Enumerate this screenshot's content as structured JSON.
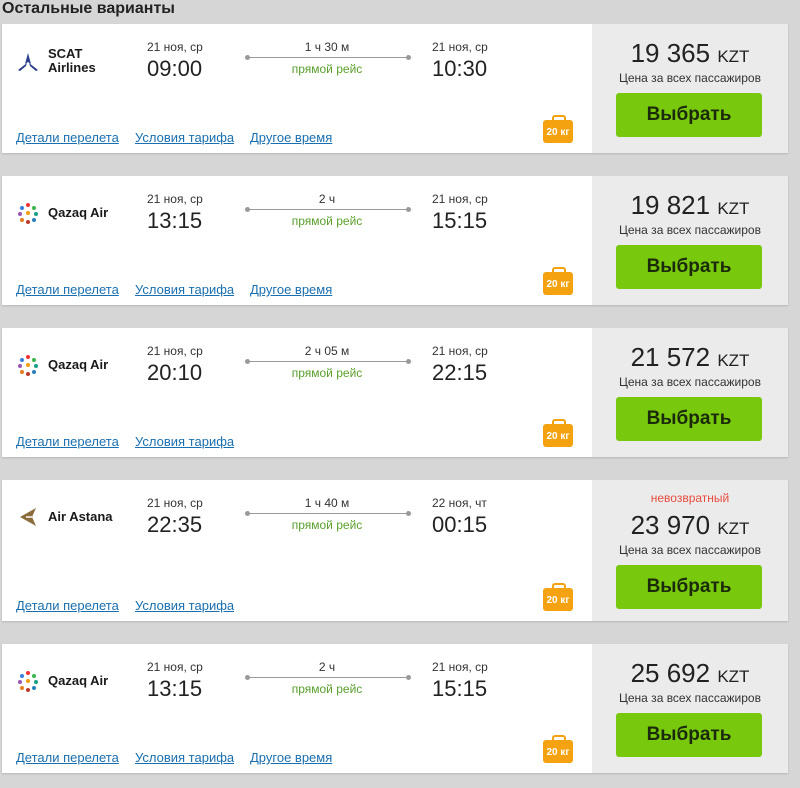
{
  "section_title": "Остальные варианты",
  "link_labels": {
    "details": "Детали перелета",
    "tariff": "Условия тарифа",
    "other_time": "Другое время"
  },
  "route_type": "прямой рейс",
  "price_note": "Цена за всех пассажиров",
  "select_label": "Выбрать",
  "baggage_label": "20 кг",
  "nonrefundable_label": "невозвратный",
  "currency": "KZT",
  "colors": {
    "accent_green": "#78c80e",
    "baggage_orange": "#f4a20f",
    "link_blue": "#1a6fb0",
    "nonref_red": "#e84c3d"
  },
  "flights": [
    {
      "airline": "SCAT Airlines",
      "airline_line1": "SCAT",
      "airline_line2": "Airlines",
      "logo_icon": "scat-airlines-logo-icon",
      "dep_date": "21 ноя, ср",
      "dep_time": "09:00",
      "duration": "1 ч 30 м",
      "arr_date": "21 ноя, ср",
      "arr_time": "10:30",
      "price": "19 365",
      "has_other_time": true,
      "nonrefundable": false
    },
    {
      "airline": "Qazaq Air",
      "logo_icon": "qazaq-air-logo-icon",
      "dep_date": "21 ноя, ср",
      "dep_time": "13:15",
      "duration": "2 ч",
      "arr_date": "21 ноя, ср",
      "arr_time": "15:15",
      "price": "19 821",
      "has_other_time": true,
      "nonrefundable": false
    },
    {
      "airline": "Qazaq Air",
      "logo_icon": "qazaq-air-logo-icon",
      "dep_date": "21 ноя, ср",
      "dep_time": "20:10",
      "duration": "2 ч 05 м",
      "arr_date": "21 ноя, ср",
      "arr_time": "22:15",
      "price": "21 572",
      "has_other_time": false,
      "nonrefundable": false
    },
    {
      "airline": "Air Astana",
      "logo_icon": "air-astana-logo-icon",
      "dep_date": "21 ноя, ср",
      "dep_time": "22:35",
      "duration": "1 ч 40 м",
      "arr_date": "22 ноя, чт",
      "arr_time": "00:15",
      "price": "23 970",
      "has_other_time": false,
      "nonrefundable": true
    },
    {
      "airline": "Qazaq Air",
      "logo_icon": "qazaq-air-logo-icon",
      "dep_date": "21 ноя, ср",
      "dep_time": "13:15",
      "duration": "2 ч",
      "arr_date": "21 ноя, ср",
      "arr_time": "15:15",
      "price": "25 692",
      "has_other_time": true,
      "nonrefundable": false
    }
  ]
}
